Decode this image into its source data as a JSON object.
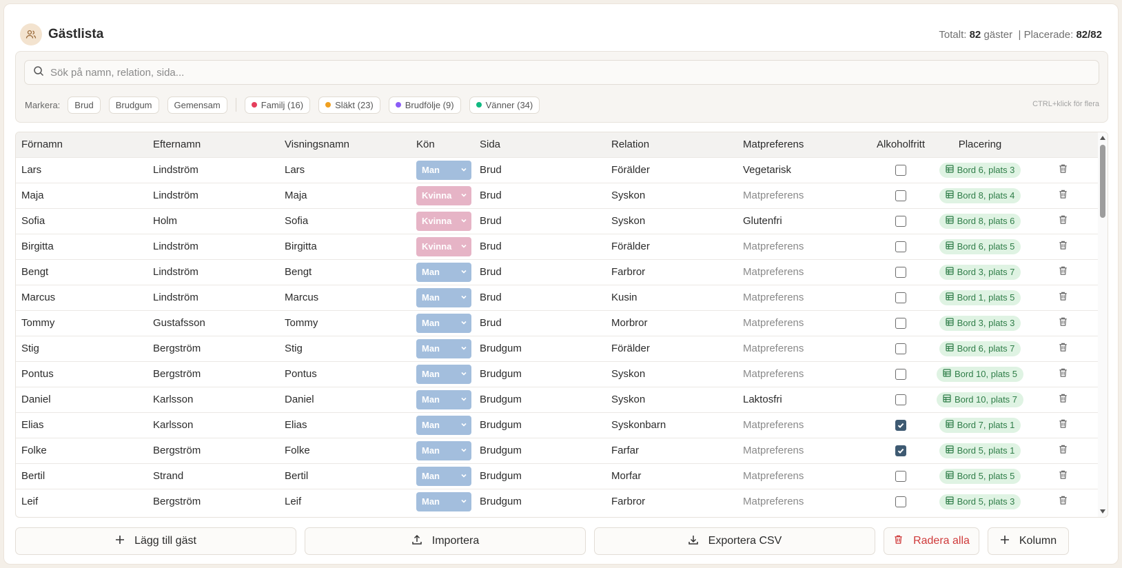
{
  "header": {
    "title": "Gästlista",
    "totals_label": "Totalt:",
    "totals_count": "82",
    "totals_unit": "gäster",
    "placed_label": "| Placerade:",
    "placed_value": "82/82"
  },
  "search": {
    "placeholder": "Sök på namn, relation, sida..."
  },
  "filters": {
    "label": "Markera:",
    "side_chips": [
      "Brud",
      "Brudgum",
      "Gemensam"
    ],
    "group_chips": [
      {
        "label": "Familj (16)",
        "color": "#e53e5c"
      },
      {
        "label": "Släkt (23)",
        "color": "#f0a020"
      },
      {
        "label": "Brudfölje (9)",
        "color": "#8b5cf6"
      },
      {
        "label": "Vänner (34)",
        "color": "#10b981"
      }
    ],
    "hint": "CTRL+klick för flera"
  },
  "table": {
    "columns": [
      "Förnamn",
      "Efternamn",
      "Visningsnamn",
      "Kön",
      "Sida",
      "Relation",
      "Matpreferens",
      "Alkoholfritt",
      "Placering"
    ],
    "rows": [
      {
        "first": "Lars",
        "last": "Lindström",
        "display": "Lars",
        "gender": "Man",
        "side": "Brud",
        "relation": "Förälder",
        "food": "Vegetarisk",
        "food_set": true,
        "alcohol_free": false,
        "seat": "Bord 6, plats 3"
      },
      {
        "first": "Maja",
        "last": "Lindström",
        "display": "Maja",
        "gender": "Kvinna",
        "side": "Brud",
        "relation": "Syskon",
        "food": "Matpreferens",
        "food_set": false,
        "alcohol_free": false,
        "seat": "Bord 8, plats 4"
      },
      {
        "first": "Sofia",
        "last": "Holm",
        "display": "Sofia",
        "gender": "Kvinna",
        "side": "Brud",
        "relation": "Syskon",
        "food": "Glutenfri",
        "food_set": true,
        "alcohol_free": false,
        "seat": "Bord 8, plats 6"
      },
      {
        "first": "Birgitta",
        "last": "Lindström",
        "display": "Birgitta",
        "gender": "Kvinna",
        "side": "Brud",
        "relation": "Förälder",
        "food": "Matpreferens",
        "food_set": false,
        "alcohol_free": false,
        "seat": "Bord 6, plats 5"
      },
      {
        "first": "Bengt",
        "last": "Lindström",
        "display": "Bengt",
        "gender": "Man",
        "side": "Brud",
        "relation": "Farbror",
        "food": "Matpreferens",
        "food_set": false,
        "alcohol_free": false,
        "seat": "Bord 3, plats 7"
      },
      {
        "first": "Marcus",
        "last": "Lindström",
        "display": "Marcus",
        "gender": "Man",
        "side": "Brud",
        "relation": "Kusin",
        "food": "Matpreferens",
        "food_set": false,
        "alcohol_free": false,
        "seat": "Bord 1, plats 5"
      },
      {
        "first": "Tommy",
        "last": "Gustafsson",
        "display": "Tommy",
        "gender": "Man",
        "side": "Brud",
        "relation": "Morbror",
        "food": "Matpreferens",
        "food_set": false,
        "alcohol_free": false,
        "seat": "Bord 3, plats 3"
      },
      {
        "first": "Stig",
        "last": "Bergström",
        "display": "Stig",
        "gender": "Man",
        "side": "Brudgum",
        "relation": "Förälder",
        "food": "Matpreferens",
        "food_set": false,
        "alcohol_free": false,
        "seat": "Bord 6, plats 7"
      },
      {
        "first": "Pontus",
        "last": "Bergström",
        "display": "Pontus",
        "gender": "Man",
        "side": "Brudgum",
        "relation": "Syskon",
        "food": "Matpreferens",
        "food_set": false,
        "alcohol_free": false,
        "seat": "Bord 10, plats 5"
      },
      {
        "first": "Daniel",
        "last": "Karlsson",
        "display": "Daniel",
        "gender": "Man",
        "side": "Brudgum",
        "relation": "Syskon",
        "food": "Laktosfri",
        "food_set": true,
        "alcohol_free": false,
        "seat": "Bord 10, plats 7"
      },
      {
        "first": "Elias",
        "last": "Karlsson",
        "display": "Elias",
        "gender": "Man",
        "side": "Brudgum",
        "relation": "Syskonbarn",
        "food": "Matpreferens",
        "food_set": false,
        "alcohol_free": true,
        "seat": "Bord 7, plats 1"
      },
      {
        "first": "Folke",
        "last": "Bergström",
        "display": "Folke",
        "gender": "Man",
        "side": "Brudgum",
        "relation": "Farfar",
        "food": "Matpreferens",
        "food_set": false,
        "alcohol_free": true,
        "seat": "Bord 5, plats 1"
      },
      {
        "first": "Bertil",
        "last": "Strand",
        "display": "Bertil",
        "gender": "Man",
        "side": "Brudgum",
        "relation": "Morfar",
        "food": "Matpreferens",
        "food_set": false,
        "alcohol_free": false,
        "seat": "Bord 5, plats 5"
      },
      {
        "first": "Leif",
        "last": "Bergström",
        "display": "Leif",
        "gender": "Man",
        "side": "Brudgum",
        "relation": "Farbror",
        "food": "Matpreferens",
        "food_set": false,
        "alcohol_free": false,
        "seat": "Bord 5, plats 3"
      }
    ]
  },
  "actions": {
    "add_guest": "Lägg till gäst",
    "import": "Importera",
    "export_csv": "Exportera CSV",
    "delete_all": "Radera alla",
    "add_column": "Kolumn"
  },
  "colors": {
    "accent_bg": "#f3e3cf",
    "man": "#a3bedd",
    "kvinna": "#e6b4c6",
    "seat_bg": "#dff3e3",
    "seat_text": "#2f7d48",
    "danger": "#cf3a3a"
  },
  "icons": {
    "app": "users-icon",
    "search": "search-icon",
    "seat": "table-grid-icon",
    "delete": "trash-icon",
    "add": "plus-icon",
    "import": "upload-icon",
    "export": "download-icon"
  }
}
